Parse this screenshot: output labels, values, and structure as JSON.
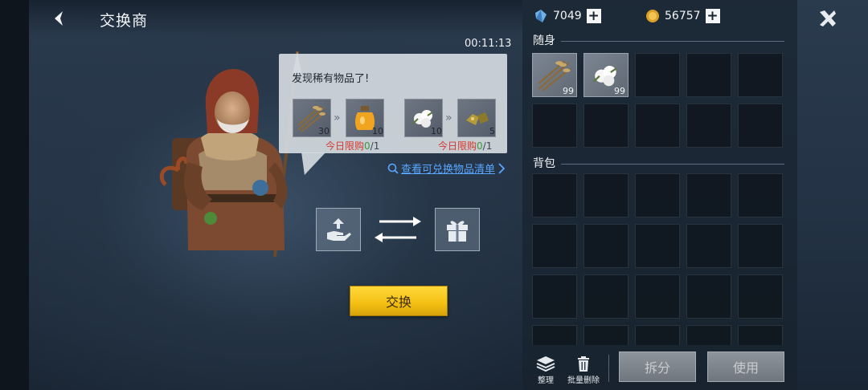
{
  "header": {
    "title": "交换商",
    "timer": "00:11:13"
  },
  "bubble": {
    "message": "发现稀有物品了!",
    "offers": [
      {
        "give_icon": "wheat-bundle-icon",
        "give_qty": "30",
        "get_icon": "honey-jar-icon",
        "get_qty": "10",
        "limit_label": "今日限购",
        "limit_used": "0",
        "limit_total": "/1"
      },
      {
        "give_icon": "cotton-icon",
        "give_qty": "10",
        "get_icon": "ore-nugget-icon",
        "get_qty": "5",
        "limit_label": "今日限购",
        "limit_used": "0",
        "limit_total": "/1"
      }
    ]
  },
  "view_list_label": "查看可兑换物品清单",
  "exchange_button_label": "交换",
  "currency": {
    "crystal_amount": "7049",
    "gold_amount": "56757"
  },
  "inventory": {
    "carry_title": "随身",
    "carry_slots": [
      {
        "icon": "wheat-bundle-icon",
        "count": "99"
      },
      {
        "icon": "cotton-icon",
        "count": "99"
      }
    ],
    "bag_title": "背包"
  },
  "toolbar": {
    "sort_label": "整理",
    "batch_delete_label": "批量删除",
    "split_label": "拆分",
    "use_label": "使用"
  },
  "colors": {
    "accent_yellow": "#f4bf12",
    "limit_red": "#d6382e",
    "link_blue": "#58a6ff"
  }
}
